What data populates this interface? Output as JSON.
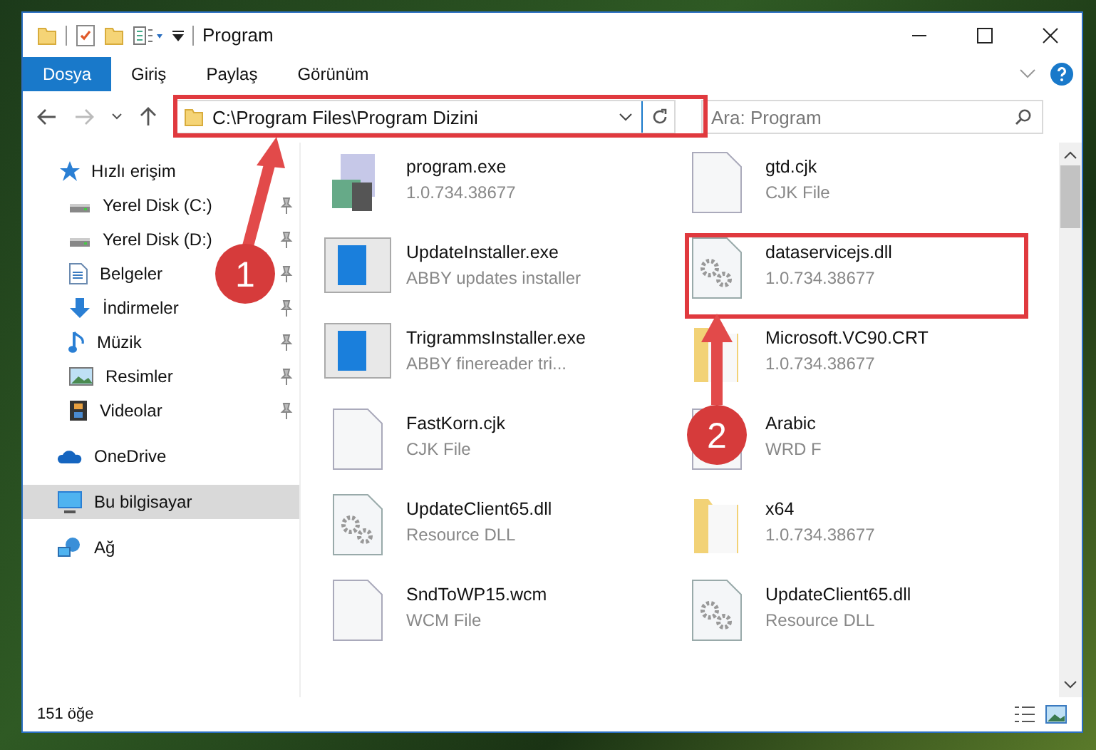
{
  "window": {
    "title": "Program"
  },
  "ribbon_tabs": [
    {
      "label": "Dosya",
      "selected": true
    },
    {
      "label": "Giriş",
      "selected": false
    },
    {
      "label": "Paylaş",
      "selected": false
    },
    {
      "label": "Görünüm",
      "selected": false
    }
  ],
  "address": {
    "path": "C:\\Program Files\\Program Dizini"
  },
  "search": {
    "placeholder": "Ara: Program"
  },
  "sidebar": {
    "items": [
      {
        "label": "Hızlı erişim",
        "kind": "star",
        "selected": false,
        "children": [
          {
            "label": "Yerel Disk (C:)",
            "kind": "drive",
            "pinned": true
          },
          {
            "label": "Yerel Disk (D:)",
            "kind": "drive",
            "pinned": true
          },
          {
            "label": "Belgeler",
            "kind": "document",
            "pinned": true
          },
          {
            "label": "İndirmeler",
            "kind": "download",
            "pinned": true
          },
          {
            "label": "Müzik",
            "kind": "music",
            "pinned": true
          },
          {
            "label": "Resimler",
            "kind": "picture",
            "pinned": true
          },
          {
            "label": "Videolar",
            "kind": "video",
            "pinned": true
          }
        ]
      },
      {
        "label": "OneDrive",
        "kind": "cloud",
        "selected": false
      },
      {
        "label": "Bu bilgisayar",
        "kind": "computer",
        "selected": true
      },
      {
        "label": "Ağ",
        "kind": "network",
        "selected": false
      }
    ]
  },
  "files": [
    {
      "name": "program.exe",
      "detail": "1.0.734.38677",
      "kind": "app"
    },
    {
      "name": "gtd.cjk",
      "detail": "CJK File",
      "kind": "blank"
    },
    {
      "name": "UpdateInstaller.exe",
      "detail": "ABBY updates installer",
      "kind": "installer"
    },
    {
      "name": "dataservicejs.dll",
      "detail": "1.0.734.38677",
      "kind": "dll"
    },
    {
      "name": "TrigrammsInstaller.exe",
      "detail": "ABBY finereader tri...",
      "kind": "installer"
    },
    {
      "name": "Microsoft.VC90.CRT",
      "detail": "1.0.734.38677",
      "kind": "folder"
    },
    {
      "name": "FastKorn.cjk",
      "detail": "CJK File",
      "kind": "blank"
    },
    {
      "name": "Arabic",
      "detail": "WRD F",
      "kind": "blank"
    },
    {
      "name": "UpdateClient65.dll",
      "detail": "Resource DLL",
      "kind": "dll"
    },
    {
      "name": "x64",
      "detail": "1.0.734.38677",
      "kind": "folder"
    },
    {
      "name": "SndToWP15.wcm",
      "detail": "WCM File",
      "kind": "blank"
    },
    {
      "name": "UpdateClient65.dll",
      "detail": "Resource DLL",
      "kind": "dll"
    }
  ],
  "status_bar": {
    "count": "151 öğe"
  },
  "annotations": [
    {
      "label": "1"
    },
    {
      "label": "2"
    }
  ]
}
